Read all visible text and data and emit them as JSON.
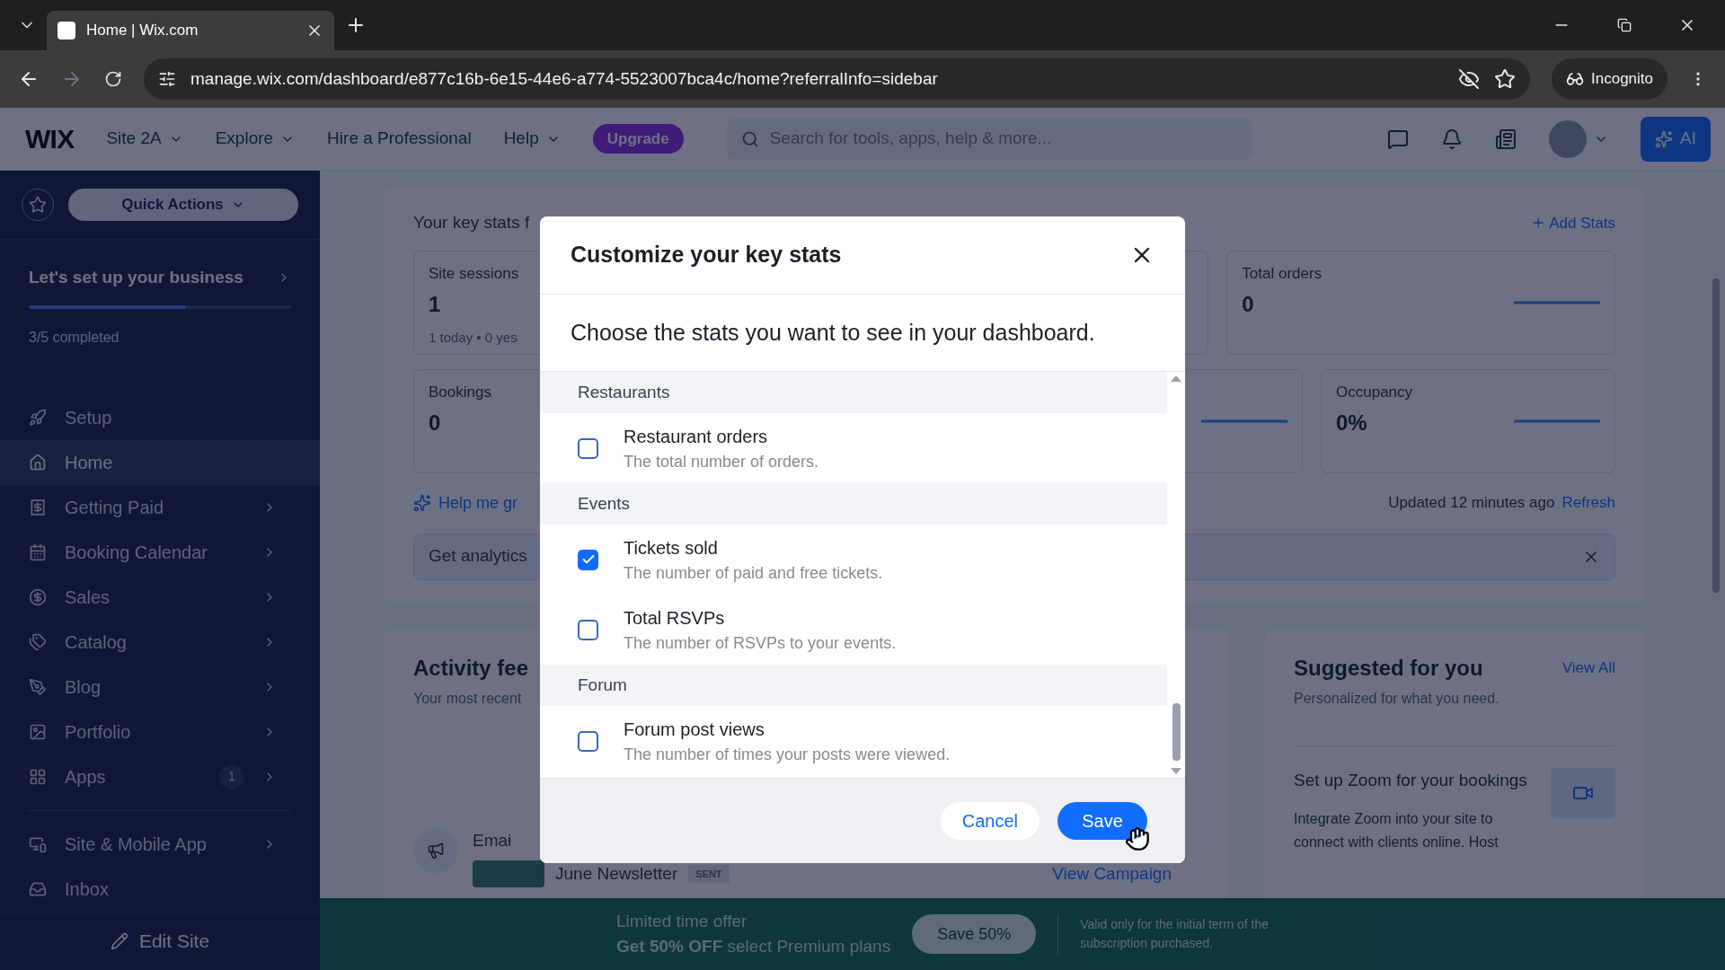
{
  "browser": {
    "tab_title": "Home | Wix.com",
    "url": "manage.wix.com/dashboard/e877c16b-6e15-44e6-a774-5523007bca4c/home?referralInfo=sidebar",
    "profile": "Incognito"
  },
  "topbar": {
    "logo": "WIX",
    "site": "Site 2A",
    "nav": [
      {
        "label": "Explore",
        "dropdown": true
      },
      {
        "label": "Hire a Professional",
        "dropdown": false
      },
      {
        "label": "Help",
        "dropdown": true
      }
    ],
    "upgrade": "Upgrade",
    "search": {
      "placeholder": "Search for tools, apps, help & more..."
    },
    "ai": "AI"
  },
  "sidebar": {
    "quick_actions": "Quick Actions",
    "setup": {
      "title": "Let's set up your business",
      "level": 0.6,
      "progress": "3/5 completed"
    },
    "items": [
      {
        "label": "Setup",
        "selected": false,
        "chevron": false
      },
      {
        "label": "Home",
        "selected": true,
        "chevron": false
      },
      {
        "label": "Getting Paid",
        "selected": false,
        "chevron": true
      },
      {
        "label": "Booking Calendar",
        "selected": false,
        "chevron": true
      },
      {
        "label": "Sales",
        "selected": false,
        "chevron": true
      },
      {
        "label": "Catalog",
        "selected": false,
        "chevron": true
      },
      {
        "label": "Blog",
        "selected": false,
        "chevron": true
      },
      {
        "label": "Portfolio",
        "selected": false,
        "chevron": true
      },
      {
        "label": "Apps",
        "selected": false,
        "chevron": true,
        "badge": "1"
      }
    ],
    "bottom_items": [
      {
        "label": "Site & Mobile App",
        "selected": false,
        "chevron": true
      },
      {
        "label": "Inbox",
        "selected": false,
        "chevron": false
      }
    ],
    "edit_site": "Edit Site"
  },
  "key_stats": {
    "title": "Your key stats f",
    "add": "Add Stats",
    "rows": [
      [
        {
          "label": "Site sessions",
          "value": "1",
          "note": "1 today • 0 yes"
        },
        {},
        {
          "label": "Total orders",
          "value": "0",
          "spark": true
        }
      ],
      [
        {
          "label": "Bookings",
          "value": "0"
        },
        {
          "spark": true
        },
        {
          "label": "Occupancy",
          "value": "0%",
          "spark": true
        }
      ]
    ],
    "help": "Help me gr",
    "updated": "Updated 12 minutes ago",
    "refresh": "Refresh",
    "banner": "Get analytics"
  },
  "activity": {
    "title": "Activity fee",
    "subtitle": "Your most recent",
    "item_title": "Emai",
    "campaign": "June Newsletter",
    "status": "SENT",
    "link": "View Campaign"
  },
  "suggested": {
    "title": "Suggested for you",
    "link": "View All",
    "subtitle": "Personalized for what you need.",
    "card_title": "Set up Zoom for your bookings",
    "card_text": "Integrate Zoom into your site to connect with clients online. Host"
  },
  "promo": {
    "line1": "Limited time offer",
    "line2": "**Get 50% OFF** select Premium plans",
    "button": "Save 50%",
    "note": "Valid only for the initial term of the subscription purchased."
  },
  "modal": {
    "title": "Customize your key stats",
    "subtitle": "Choose the stats you want to see in your dashboard.",
    "groups": [
      {
        "name": "Restaurants",
        "items": [
          {
            "label": "Restaurant orders",
            "description": "The total number of orders.",
            "checked": false
          }
        ]
      },
      {
        "name": "Events",
        "items": [
          {
            "label": "Tickets sold",
            "description": "The number of paid and free tickets.",
            "checked": true
          },
          {
            "label": "Total RSVPs",
            "description": "The number of RSVPs to your events.",
            "checked": false
          }
        ]
      },
      {
        "name": "Forum",
        "items": [
          {
            "label": "Forum post views",
            "description": "The number of times your posts were viewed.",
            "checked": false
          }
        ]
      }
    ],
    "cancel": "Cancel",
    "save": "Save"
  }
}
